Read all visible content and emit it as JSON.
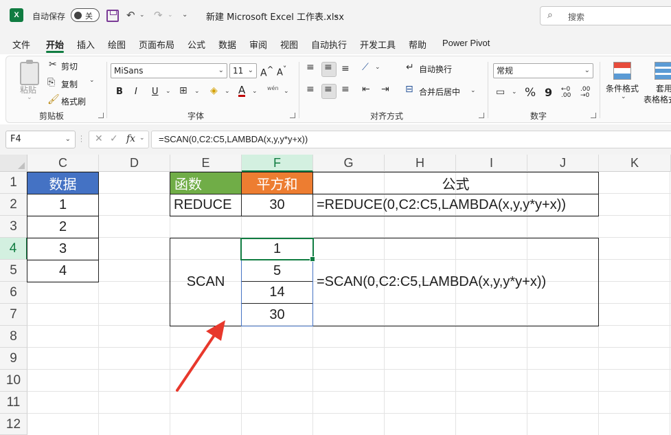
{
  "titlebar": {
    "autosave_label": "自动保存",
    "autosave_state": "关",
    "document_title": "新建 Microsoft Excel 工作表.xlsx",
    "search_placeholder": "搜索"
  },
  "tabs": [
    "文件",
    "开始",
    "插入",
    "绘图",
    "页面布局",
    "公式",
    "数据",
    "审阅",
    "视图",
    "自动执行",
    "开发工具",
    "帮助",
    "Power Pivot"
  ],
  "active_tab": "开始",
  "ribbon": {
    "clipboard": {
      "paste": "粘贴",
      "cut": "剪切",
      "copy": "复制",
      "format_painter": "格式刷",
      "group": "剪贴板"
    },
    "font": {
      "name": "MiSans",
      "size": "11",
      "bold": "B",
      "italic": "I",
      "underline": "U",
      "grow": "A^",
      "shrink": "A˅",
      "group": "字体"
    },
    "alignment": {
      "wrap_text": "自动换行",
      "merge_center": "合并后居中",
      "group": "对齐方式"
    },
    "number": {
      "format": "常规",
      "percent": "%",
      "comma": "9",
      "group": "数字"
    },
    "styles": {
      "conditional_format": "条件格式",
      "table_format_1": "套用",
      "table_format_2": "表格格式"
    }
  },
  "formula_bar": {
    "name_box": "F4",
    "fx_label": "fx",
    "formula": "=SCAN(0,C2:C5,LAMBDA(x,y,y*y+x))"
  },
  "columns": [
    "C",
    "D",
    "E",
    "F",
    "G",
    "H",
    "I",
    "J",
    "K"
  ],
  "selected_column": "F",
  "rows": [
    "1",
    "2",
    "3",
    "4",
    "5",
    "6",
    "7",
    "8",
    "9",
    "10",
    "11",
    "12"
  ],
  "selected_row": "4",
  "sheet": {
    "data_header": "数据",
    "data_values": [
      "1",
      "2",
      "3",
      "4"
    ],
    "func_header": "函数",
    "sumsq_header": "平方和",
    "formula_header": "公式",
    "reduce_label": "REDUCE",
    "reduce_value": "30",
    "reduce_formula": "=REDUCE(0,C2:C5,LAMBDA(x,y,y*y+x))",
    "scan_label": "SCAN",
    "scan_values": [
      "1",
      "5",
      "14",
      "30"
    ],
    "scan_formula": "=SCAN(0,C2:C5,LAMBDA(x,y,y*y+x))"
  },
  "colors": {
    "excel_green": "#107c41",
    "header_blue": "#4472c4",
    "header_green": "#70ad47",
    "header_orange": "#ed7d31",
    "arrow_red": "#e8382c"
  }
}
